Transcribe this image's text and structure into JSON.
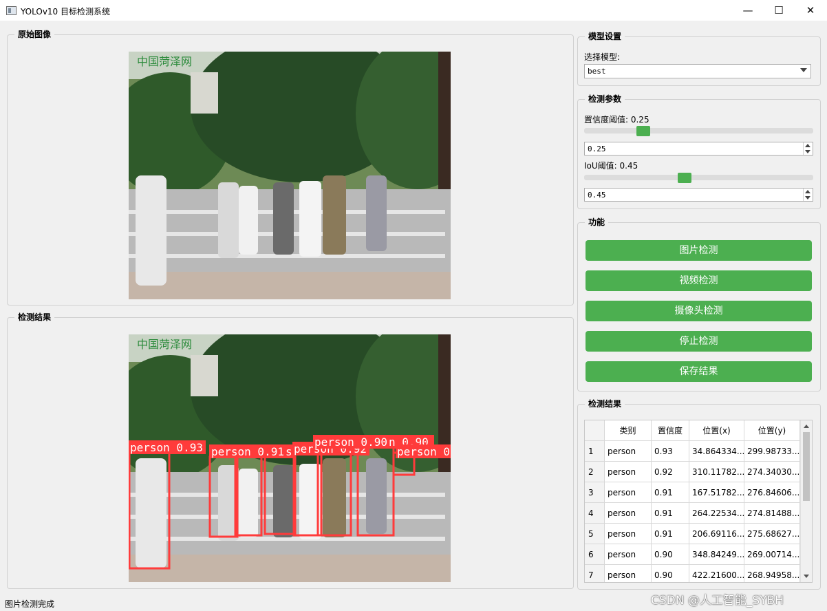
{
  "window": {
    "title": "YOLOv10 目标检测系统",
    "icon": "app-window-icon",
    "min_glyph": "—",
    "max_glyph": "☐",
    "close_glyph": "✕"
  },
  "original_panel": {
    "title": "原始图像"
  },
  "result_panel": {
    "title": "检测结果",
    "detections": [
      {
        "label": "person 0.93"
      },
      {
        "label": "person 0.91"
      },
      {
        "label": "s"
      },
      {
        "label": "person 0.92"
      },
      {
        "label": "person 0.90"
      },
      {
        "label": "n 0.90"
      },
      {
        "label": "person 0"
      }
    ],
    "box_color": "#ff3b3b"
  },
  "model_settings": {
    "title": "模型设置",
    "select_label": "选择模型:",
    "selected": "best"
  },
  "params": {
    "title": "检测参数",
    "conf_label": "置信度阈值: 0.25",
    "conf_value": "0.25",
    "conf_level": 0.25,
    "iou_label": "IoU阈值: 0.45",
    "iou_value": "0.45",
    "iou_level": 0.45,
    "accent": "#4caf50"
  },
  "functions": {
    "title": "功能",
    "buttons": [
      "图片检测",
      "视频检测",
      "摄像头检测",
      "停止检测",
      "保存结果"
    ]
  },
  "results_table": {
    "title": "检测结果",
    "headers": [
      "",
      "类别",
      "置信度",
      "位置(x)",
      "位置(y)"
    ],
    "rows": [
      [
        "1",
        "person",
        "0.93",
        "34.864334...",
        "299.98733..."
      ],
      [
        "2",
        "person",
        "0.92",
        "310.11782...",
        "274.34030..."
      ],
      [
        "3",
        "person",
        "0.91",
        "167.51782...",
        "276.84606..."
      ],
      [
        "4",
        "person",
        "0.91",
        "264.22534...",
        "274.81488..."
      ],
      [
        "5",
        "person",
        "0.91",
        "206.69116...",
        "275.68627..."
      ],
      [
        "6",
        "person",
        "0.90",
        "348.84249...",
        "269.00714..."
      ],
      [
        "7",
        "person",
        "0.90",
        "422.21600...",
        "268.94958..."
      ]
    ]
  },
  "status_bar": {
    "text": "图片检测完成"
  },
  "watermark": {
    "text": "CSDN @人工智能_SYBH"
  }
}
